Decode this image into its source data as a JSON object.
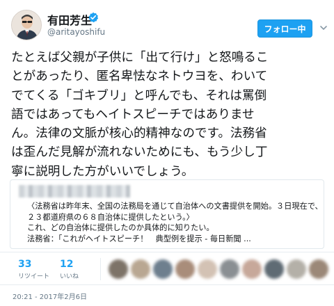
{
  "user": {
    "display_name": "有田芳生",
    "handle": "@aritayoshifu",
    "verified": true
  },
  "follow_button": {
    "label": "フォロー中"
  },
  "tweet": {
    "lines": [
      "たとえば父親が子供に「出て行け」と怒鳴るこ",
      "とがあったり、匿名卑怯なネトウヨを、わいて",
      "でてくる「ゴキブリ」と呼んでも、それは罵倒",
      "語ではあってもヘイトスピーチではありませ",
      "ん。法律の文脈が核心的精神なのです。法務省",
      "は歪んだ見解が流れないためにも、もう少し丁",
      "寧に説明した方がいいでしょう。"
    ]
  },
  "quoted_card": {
    "lines": [
      "〈法務省は昨年末、全国の法務局を通じて自治体への文書提供を開始。３日現在で、",
      "２３都道府県の６８自治体に提供したという。〉",
      "これ、どの自治体に提供したのか具体的に知りたい。",
      "法務省：「これがヘイトスピーチ！　典型例を提示 - 毎日新聞 ..."
    ]
  },
  "stats": {
    "retweets": {
      "count": "33",
      "label": "リツイート"
    },
    "likes": {
      "count": "12",
      "label": "いいね"
    }
  },
  "timestamp": "20:21 - 2017年2月6日",
  "colors": {
    "accent": "#1da1f2",
    "text": "#14171a",
    "muted": "#657786",
    "border": "#e6ecf0"
  },
  "icons": {
    "verified": "verified-badge-icon",
    "dropdown": "chevron-down-icon"
  }
}
